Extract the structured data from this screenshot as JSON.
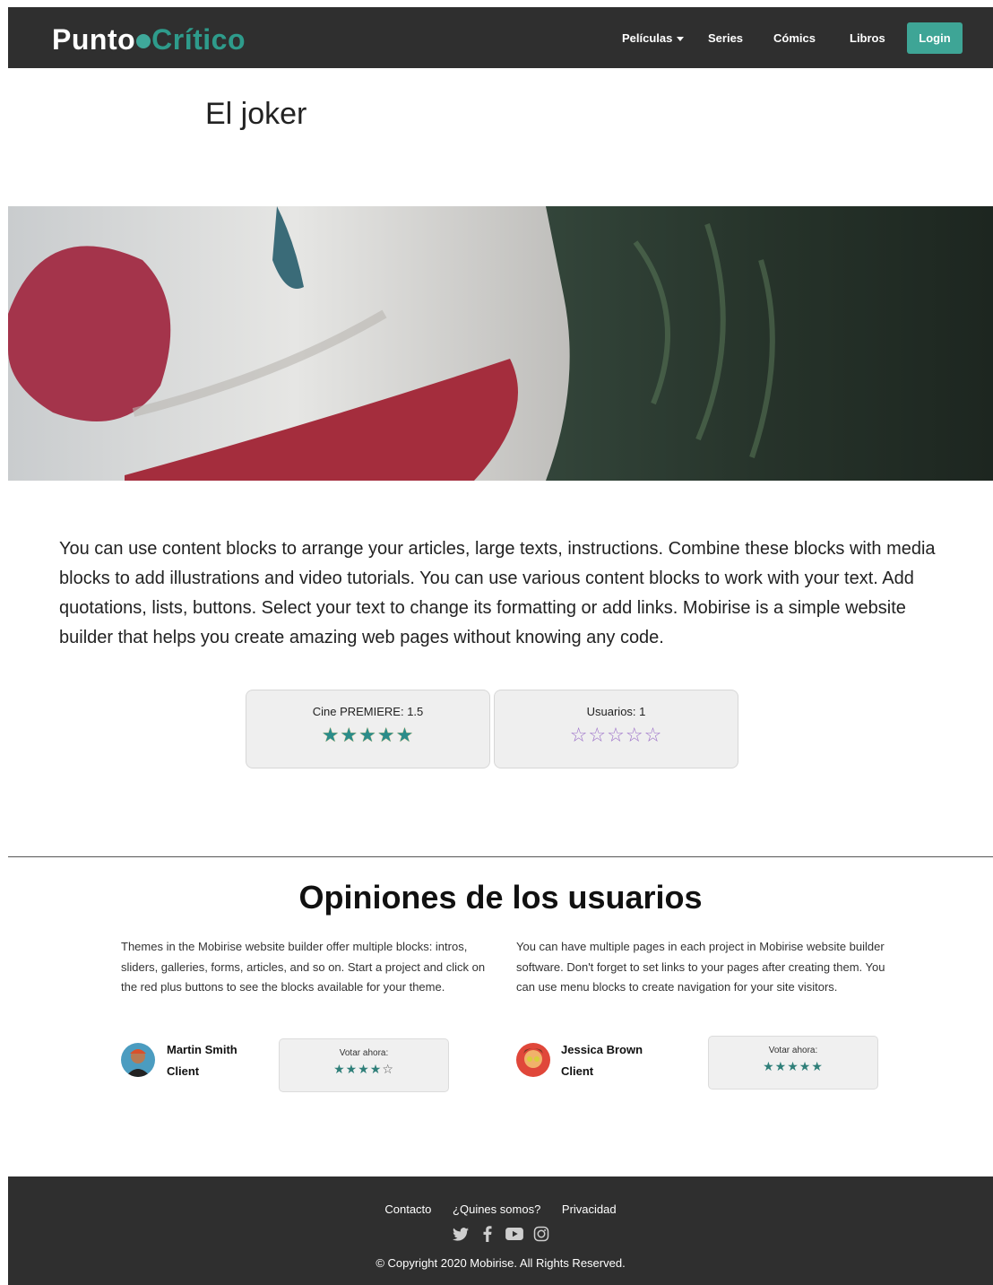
{
  "brand": {
    "part1": "Punto",
    "part2": "Crítico"
  },
  "nav": {
    "items": [
      "Películas",
      "Series",
      "Cómics",
      "Libros"
    ],
    "login": "Login"
  },
  "page": {
    "title": "El joker",
    "intro": "You can use content blocks to arrange your articles, large texts, instructions. Combine these blocks with media blocks to add illustrations and video tutorials. You can use various content blocks to work with your text. Add quotations, lists, buttons. Select your text to change its formatting or add links. Mobirise is a simple website builder that helps you create amazing web pages without knowing any code."
  },
  "ratings": [
    {
      "label": "Cine PREMIERE: 1.5",
      "stars": "★★★★★"
    },
    {
      "label": "Usuarios: 1",
      "stars": "☆☆☆☆☆"
    }
  ],
  "reviews": {
    "title": "Opiniones de los usuarios",
    "items": [
      {
        "text": "Themes in the Mobirise website builder offer multiple blocks: intros, sliders, galleries, forms, articles, and so on. Start a project and click on the red plus buttons to see the blocks available for your theme.",
        "name": "Martin Smith",
        "role": "Client",
        "vote_label": "Votar ahora:",
        "filled_stars": "★★★★",
        "empty_stars": "☆"
      },
      {
        "text": "You can have multiple pages in each project in Mobirise website builder software. Don't forget to set links to your pages after creating them. You can use menu blocks to create navigation for your site visitors.",
        "name": "Jessica Brown",
        "role": "Client",
        "vote_label": "Votar ahora:",
        "filled_stars": "★★★★★",
        "empty_stars": ""
      }
    ]
  },
  "footer": {
    "links": [
      "Contacto",
      "¿Quines somos?",
      "Privacidad"
    ],
    "social_icons": [
      "twitter-icon",
      "facebook-icon",
      "youtube-icon",
      "instagram-icon"
    ],
    "copyright": "© Copyright 2020 Mobirise. All Rights Reserved."
  },
  "colors": {
    "navbar": "#2f2f2f",
    "accent": "#3ea596",
    "footer": "#2f2f2f"
  }
}
